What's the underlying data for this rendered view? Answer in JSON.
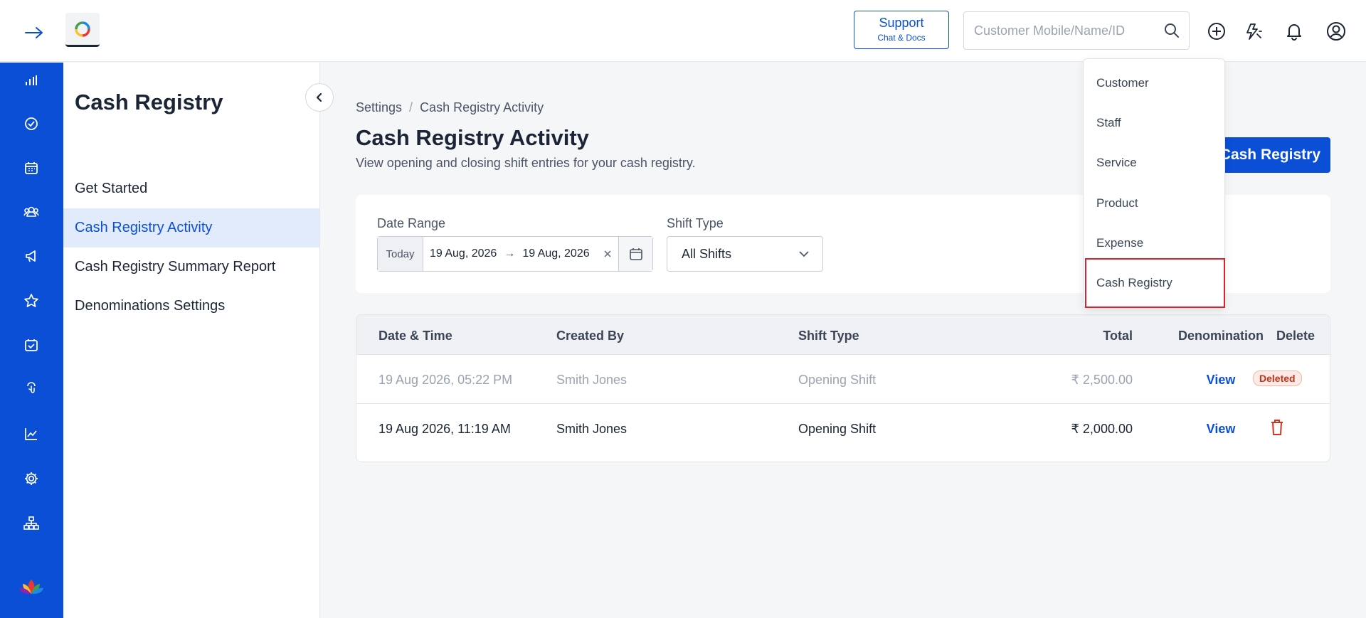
{
  "topbar": {
    "support": {
      "title": "Support",
      "subtitle": "Chat & Docs"
    },
    "search": {
      "placeholder": "Customer Mobile/Name/ID"
    },
    "icons": [
      "expand-arrow-icon",
      "add-circle-icon",
      "theme-toggle-icon",
      "bell-icon",
      "user-icon"
    ]
  },
  "rail": {
    "icons": [
      "dashboard-chart-icon",
      "check-circle-icon",
      "calendar-icon",
      "group-icon",
      "megaphone-icon",
      "star-icon",
      "calendar-check-icon",
      "touch-icon",
      "trend-line-icon",
      "settings-gear-icon",
      "hierarchy-icon"
    ]
  },
  "sidebar": {
    "title": "Cash Registry",
    "items": [
      {
        "label": "Get Started"
      },
      {
        "label": "Cash Registry Activity"
      },
      {
        "label": "Cash Registry Summary Report"
      },
      {
        "label": "Denominations Settings"
      }
    ]
  },
  "breadcrumb": {
    "root": "Settings",
    "separator": "/",
    "current": "Cash Registry Activity"
  },
  "page": {
    "title": "Cash Registry Activity",
    "subtitle": "View opening and closing shift entries for your cash registry.",
    "primary_button": "Cash Registry"
  },
  "filters": {
    "date_range_label": "Date Range",
    "today_label": "Today",
    "start_date": "19 Aug, 2026",
    "arrow": "→",
    "end_date": "19 Aug, 2026",
    "shift_type_label": "Shift Type",
    "shift_type_value": "All Shifts"
  },
  "table": {
    "headers": {
      "datetime": "Date & Time",
      "created_by": "Created By",
      "shift_type": "Shift Type",
      "total": "Total",
      "denomination": "Denomination",
      "delete": "Delete"
    },
    "rows": [
      {
        "datetime": "19 Aug 2026, 05:22 PM",
        "created_by": "Smith Jones",
        "shift_type": "Opening Shift",
        "total": "₹ 2,500.00",
        "denomination": "View",
        "status": "Deleted"
      },
      {
        "datetime": "19 Aug 2026, 11:19 AM",
        "created_by": "Smith Jones",
        "shift_type": "Opening Shift",
        "total": "₹ 2,000.00",
        "denomination": "View"
      }
    ]
  },
  "dropdown": {
    "items": [
      {
        "label": "Customer"
      },
      {
        "label": "Staff"
      },
      {
        "label": "Service"
      },
      {
        "label": "Product"
      },
      {
        "label": "Expense"
      },
      {
        "label": "Cash Registry"
      }
    ],
    "highlighted": "Cash Registry"
  },
  "colors": {
    "brand": "#0b4fd6",
    "active_bg": "#e1ebfb",
    "danger": "#c0341d",
    "highlight_border": "#e2202b"
  }
}
